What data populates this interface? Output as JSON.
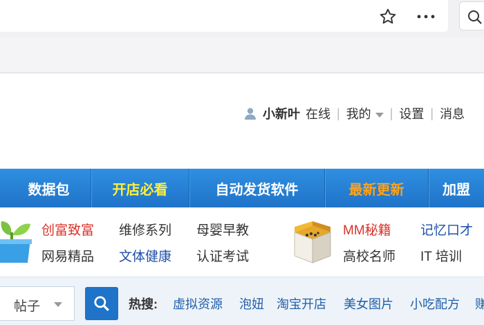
{
  "userbar": {
    "username": "小新叶",
    "status": "在线",
    "my_label": "我的",
    "settings_label": "设置",
    "messages_label": "消息"
  },
  "nav": {
    "items": [
      {
        "label": "数据包",
        "color": "#ffffff"
      },
      {
        "label": "开店必看",
        "color": "#ffef3a"
      },
      {
        "label": "自动发货软件",
        "color": "#ffffff"
      },
      {
        "label": "最新更新",
        "color": "#ffa21a"
      },
      {
        "label": "加盟",
        "color": "#ffffff"
      }
    ]
  },
  "categories": {
    "left": [
      {
        "label": "创富致富",
        "color": "#d9332a"
      },
      {
        "label": "维修系列",
        "color": "#333333"
      },
      {
        "label": "母婴早教",
        "color": "#333333"
      },
      {
        "label": "网易精品",
        "color": "#333333"
      },
      {
        "label": "文体健康",
        "color": "#1f4fa8"
      },
      {
        "label": "认证考试",
        "color": "#333333"
      }
    ],
    "right": [
      {
        "label": "MM秘籍",
        "color": "#d9332a"
      },
      {
        "label": "记忆口才",
        "color": "#1f4fa8"
      },
      {
        "label": "高校名师",
        "color": "#333333"
      },
      {
        "label": "IT 培训",
        "color": "#333333"
      }
    ]
  },
  "search": {
    "select_value": "帖子",
    "hot_label": "热搜:",
    "hot_terms": [
      "虚拟资源",
      "泡妞",
      "淘宝开店",
      "美女图片",
      "小吃配方",
      "赚"
    ]
  },
  "icons": {
    "star": "favorite-star-icon",
    "more": "more-options-icon",
    "search": "search-icon",
    "user": "user-icon",
    "plant": "plant-icon",
    "box": "treasure-box-icon"
  },
  "colors": {
    "nav_blue": "#1f73c8",
    "link_blue": "#1f5ea8",
    "accent_red": "#d9332a"
  }
}
